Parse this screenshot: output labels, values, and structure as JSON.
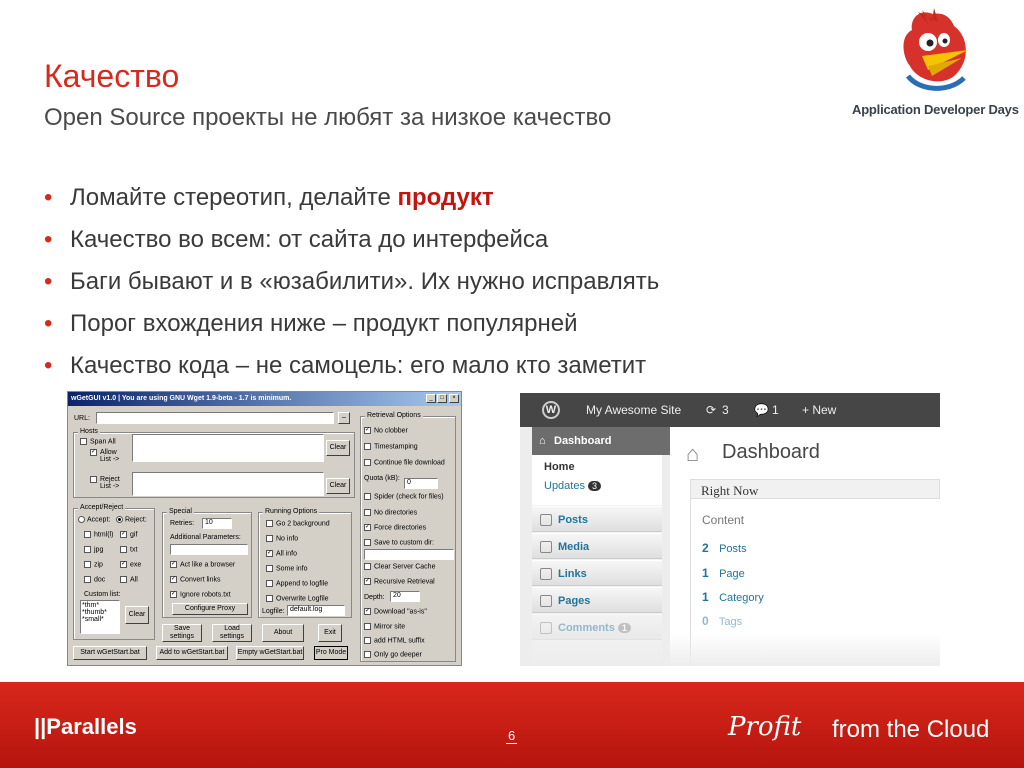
{
  "slide": {
    "title": "Качество",
    "subtitle": "Open Source проекты не любят за низкое качество",
    "bullets": [
      {
        "pre": "Ломайте стереотип, делайте ",
        "highlight": "продукт"
      },
      {
        "pre": "Качество во всем: от сайта до интерфейса"
      },
      {
        "pre": "Баги бывают и в «юзабилити». Их нужно исправлять"
      },
      {
        "pre": "Порог вхождения ниже – продукт популярней"
      },
      {
        "pre": "Качество кода – не самоцель: его мало кто заметит"
      }
    ],
    "page_number": "6",
    "accent_color": "#d52b1e"
  },
  "logo": {
    "text": "Application Developer Days",
    "icon": "woodpecker-bird-icon"
  },
  "footer": {
    "brand": "||Parallels",
    "tagline_script": "Profit",
    "tagline": "from the Cloud"
  },
  "wget": {
    "title": "wGetGUI v1.0  |  You are using GNU Wget 1.9-beta - 1.7 is minimum.",
    "url_label": "URL:",
    "hosts_label": "Hosts",
    "span_all": "Span All",
    "allow_list": "Allow List ->",
    "reject_list": "Reject List ->",
    "clear": "Clear",
    "accept_reject": "Accept/Reject",
    "accept": "Accept:",
    "reject": "Reject:",
    "types_left": [
      "html(l)",
      "jpg",
      "zip",
      "doc"
    ],
    "types_right": [
      "gif",
      "txt",
      "exe",
      "All"
    ],
    "custom_list": "Custom list:",
    "custom_items": [
      "*thm*",
      "*thumb*",
      "*small*"
    ],
    "special": "Special",
    "retries": "Retries:",
    "retries_val": "10",
    "additional": "Additional Parameters:",
    "special_opts": [
      "Act like a browser",
      "Convert links",
      "Ignore robots.txt"
    ],
    "configure_proxy": "Configure Proxy",
    "running": "Running Options",
    "running_opts": [
      "Go 2 background",
      "No info",
      "All info",
      "Some info",
      "Append to logfile",
      "Overwrite Logfile"
    ],
    "logfile": "Logfile:",
    "logfile_val": "default.log",
    "retrieval": "Retrieval Options",
    "retrieval_opts_a": [
      "No clobber",
      "Timestamping",
      "Continue file download"
    ],
    "quota": "Quota (kB):",
    "quota_val": "0",
    "retrieval_opts_b": [
      "Spider (check for files)",
      "No directories",
      "Force directories",
      "Save to custom dir:"
    ],
    "retrieval_opts_c": [
      "Clear Server Cache",
      "Recursive Retrieval"
    ],
    "depth": "Depth:",
    "depth_val": "20",
    "retrieval_opts_d": [
      "Download \"as-is\"",
      "Mirror site",
      "add HTML suffix",
      "Only go deeper"
    ],
    "save_settings": "Save settings",
    "load_settings": "Load settings",
    "about": "About",
    "exit": "Exit",
    "start_bat": "Start wGetStart.bat",
    "add_bat": "Add to wGetStart.bat",
    "empty_bat": "Empty wGetStart.bat",
    "pro_mode": "Pro Mode"
  },
  "wp": {
    "site_name": "My Awesome Site",
    "updates_count": "3",
    "comments_count": "1",
    "new_label": "+ New",
    "dashboard_menu": "Dashboard",
    "home": "Home",
    "updates": "Updates",
    "updates_badge": "3",
    "menu": [
      "Posts",
      "Media",
      "Links",
      "Pages",
      "Comments"
    ],
    "comments_badge": "1",
    "page_title": "Dashboard",
    "right_now": "Right Now",
    "content": "Content",
    "stats": [
      {
        "n": "2",
        "label": "Posts"
      },
      {
        "n": "1",
        "label": "Page"
      },
      {
        "n": "1",
        "label": "Category"
      },
      {
        "n": "0",
        "label": "Tags"
      }
    ]
  }
}
